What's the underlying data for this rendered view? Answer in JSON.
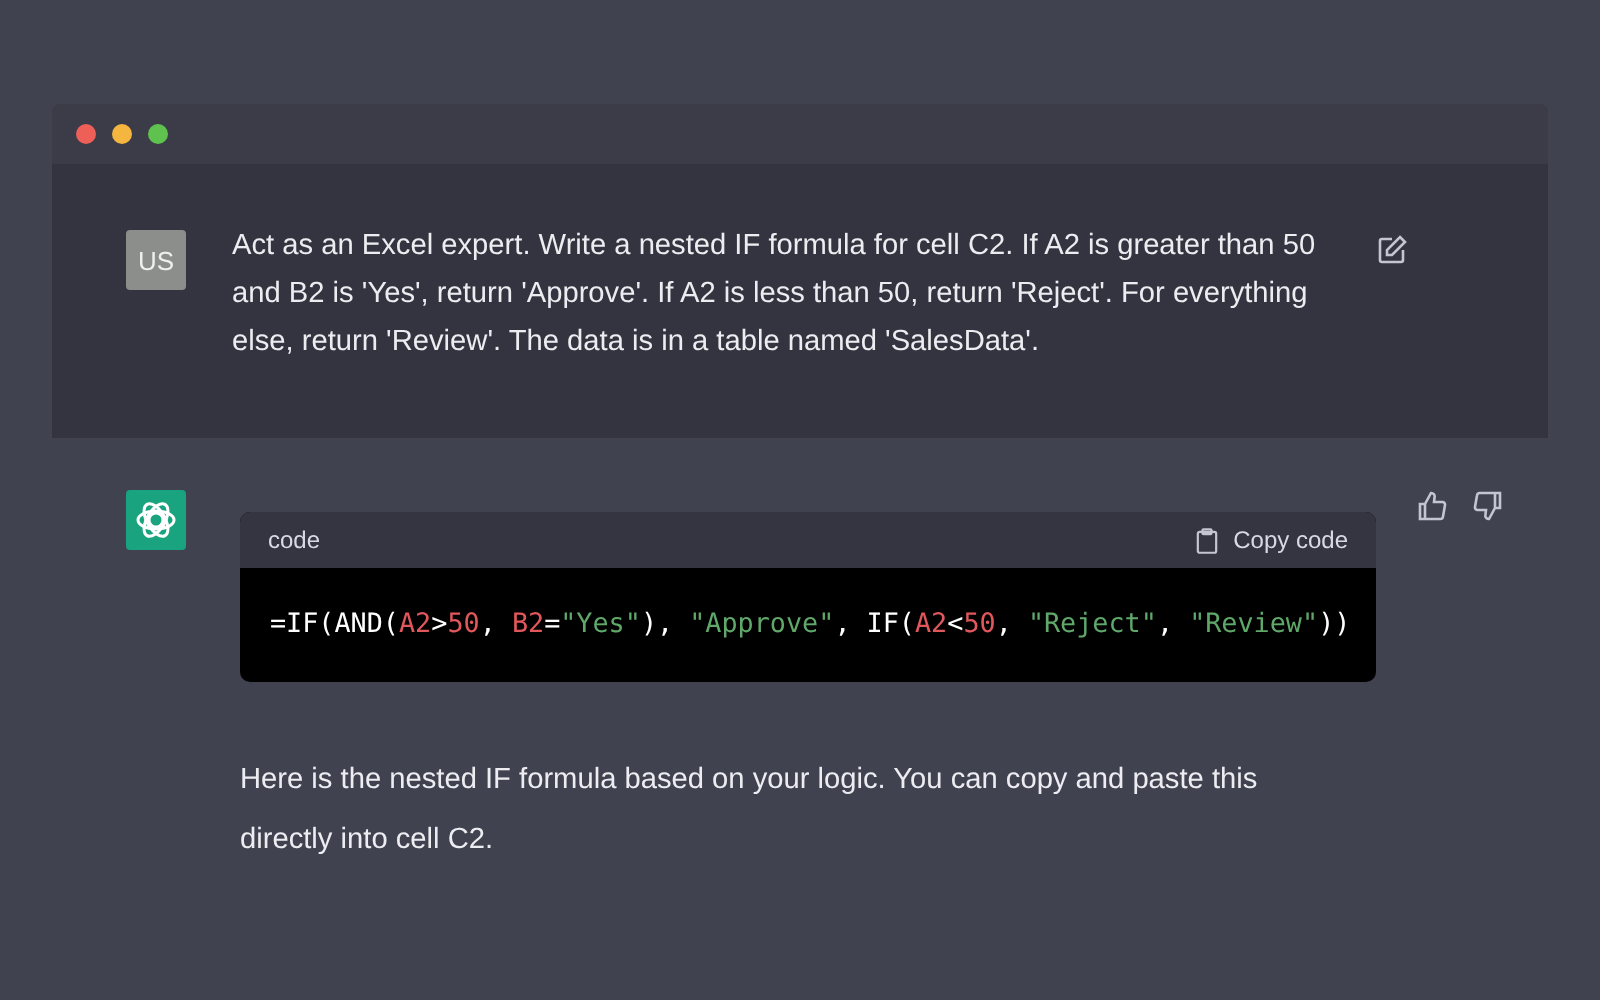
{
  "window": {
    "traffic_lights": [
      {
        "color": "#ed5f57"
      },
      {
        "color": "#f4b63f"
      },
      {
        "color": "#5fc24f"
      }
    ]
  },
  "user_message": {
    "avatar": "US",
    "text": "Act as an Excel expert. Write a nested IF formula for cell C2. If A2 is greater than 50 and B2 is 'Yes', return 'Approve'. If A2 is less than 50, return 'Reject'. For everything else, return 'Review'. The data is in a table named 'SalesData'."
  },
  "assistant_message": {
    "code_block": {
      "language": "code",
      "copy_label": "Copy code",
      "tokens": [
        {
          "kind": "plain",
          "text": "=IF(AND("
        },
        {
          "kind": "ref",
          "text": "A2"
        },
        {
          "kind": "plain",
          "text": ">"
        },
        {
          "kind": "num",
          "text": "50"
        },
        {
          "kind": "plain",
          "text": ", "
        },
        {
          "kind": "ref",
          "text": "B2"
        },
        {
          "kind": "plain",
          "text": "="
        },
        {
          "kind": "str",
          "text": "\"Yes\""
        },
        {
          "kind": "plain",
          "text": "), "
        },
        {
          "kind": "str",
          "text": "\"Approve\""
        },
        {
          "kind": "plain",
          "text": ", IF("
        },
        {
          "kind": "ref",
          "text": "A2"
        },
        {
          "kind": "plain",
          "text": "<"
        },
        {
          "kind": "num",
          "text": "50"
        },
        {
          "kind": "plain",
          "text": ", "
        },
        {
          "kind": "str",
          "text": "\"Reject\""
        },
        {
          "kind": "plain",
          "text": ", "
        },
        {
          "kind": "str",
          "text": "\"Review\""
        },
        {
          "kind": "plain",
          "text": "))"
        }
      ]
    },
    "text": "Here is the nested IF formula based on your logic. You can copy and paste this directly into cell C2."
  }
}
